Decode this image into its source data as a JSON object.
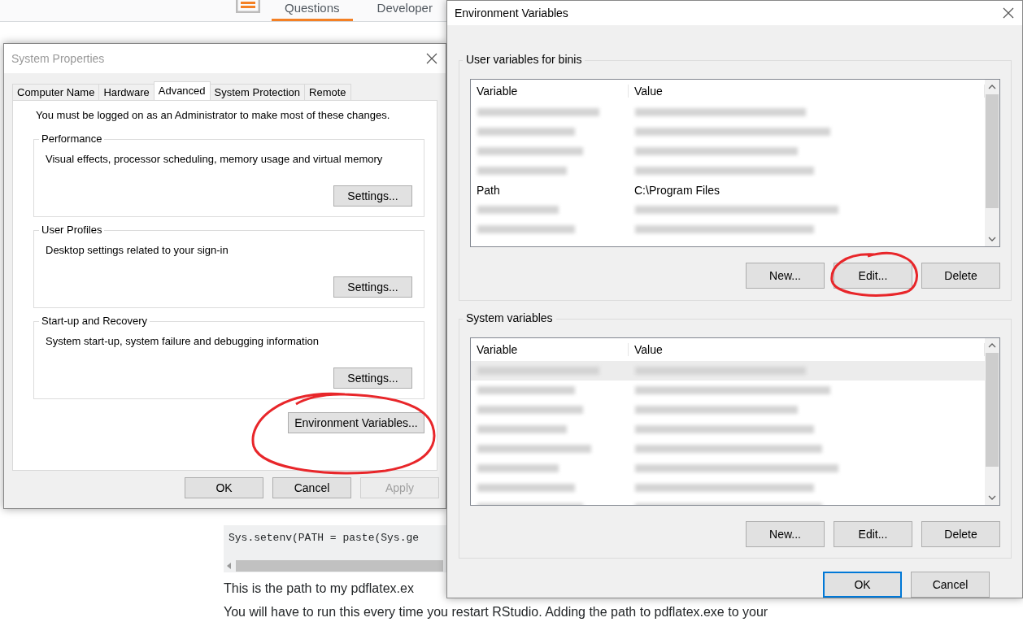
{
  "background_page": {
    "nav": [
      {
        "label": "Questions",
        "selected": true
      },
      {
        "label": "Developer",
        "selected": false
      }
    ],
    "code": "Sys.setenv(PATH = paste(Sys.ge",
    "paragraphs": [
      "This is the path to my pdflatex.ex",
      "You will have to run this every time you restart RStudio. Adding the path to pdflatex.exe to your"
    ]
  },
  "system_properties": {
    "title": "System Properties",
    "tabs": [
      {
        "label": "Computer Name",
        "selected": false
      },
      {
        "label": "Hardware",
        "selected": false
      },
      {
        "label": "Advanced",
        "selected": true
      },
      {
        "label": "System Protection",
        "selected": false
      },
      {
        "label": "Remote",
        "selected": false
      }
    ],
    "notice": "You must be logged on as an Administrator to make most of these changes.",
    "groups": [
      {
        "title": "Performance",
        "description": "Visual effects, processor scheduling, memory usage and virtual memory",
        "button": "Settings..."
      },
      {
        "title": "User Profiles",
        "description": "Desktop settings related to your sign-in",
        "button": "Settings..."
      },
      {
        "title": "Start-up and Recovery",
        "description": "System start-up, system failure and debugging information",
        "button": "Settings..."
      }
    ],
    "env_button": "Environment Variables...",
    "buttons": [
      {
        "label": "OK",
        "disabled": false
      },
      {
        "label": "Cancel",
        "disabled": false
      },
      {
        "label": "Apply",
        "disabled": true
      }
    ]
  },
  "environment_variables": {
    "title": "Environment Variables",
    "sections": [
      {
        "title": "User variables for binis",
        "columns": [
          "Variable",
          "Value"
        ],
        "rows": [
          {
            "kind": "blurred",
            "selected": false
          },
          {
            "kind": "blurred",
            "selected": false
          },
          {
            "kind": "blurred",
            "selected": false
          },
          {
            "kind": "blurred",
            "selected": false
          },
          {
            "kind": "text",
            "selected": false,
            "variable": "Path",
            "value": "C:\\Program Files"
          },
          {
            "kind": "blurred",
            "selected": false
          },
          {
            "kind": "blurred",
            "selected": false
          }
        ],
        "buttons": [
          {
            "label": "New...",
            "circled": false
          },
          {
            "label": "Edit...",
            "circled": true
          },
          {
            "label": "Delete",
            "circled": false
          }
        ]
      },
      {
        "title": "System variables",
        "columns": [
          "Variable",
          "Value"
        ],
        "rows": [
          {
            "kind": "blurred",
            "selected": true
          },
          {
            "kind": "blurred",
            "selected": false
          },
          {
            "kind": "blurred",
            "selected": false
          },
          {
            "kind": "blurred",
            "selected": false
          },
          {
            "kind": "blurred",
            "selected": false
          },
          {
            "kind": "blurred",
            "selected": false
          },
          {
            "kind": "blurred",
            "selected": false
          },
          {
            "kind": "blurred",
            "selected": false
          }
        ],
        "buttons": [
          {
            "label": "New...",
            "circled": false
          },
          {
            "label": "Edit...",
            "circled": false
          },
          {
            "label": "Delete",
            "circled": false
          }
        ]
      }
    ],
    "buttons": [
      {
        "label": "OK",
        "default": true
      },
      {
        "label": "Cancel",
        "default": false
      }
    ]
  }
}
